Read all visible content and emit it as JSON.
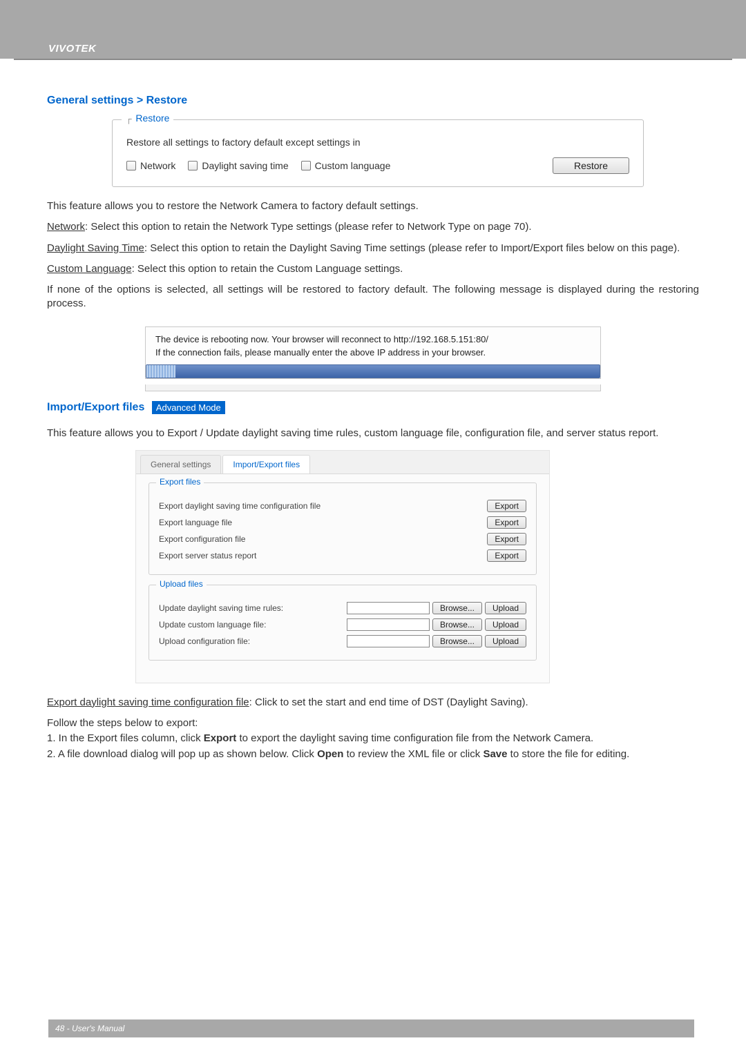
{
  "brand": "VIVOTEK",
  "section1_title": "General settings > Restore",
  "restore": {
    "legend": "Restore",
    "line1": "Restore all settings to factory default except settings in",
    "chk_network": "Network",
    "chk_dst": "Daylight saving time",
    "chk_lang": "Custom language",
    "button": "Restore"
  },
  "p1": "This feature allows you to restore the Network Camera to factory default settings.",
  "p2_u": "Network",
  "p2": ": Select this option to retain the Network Type settings (please refer to Network Type on page 70).",
  "p3_u": "Daylight Saving Time",
  "p3": ": Select this option to retain the Daylight Saving Time settings (please refer to Import/Export files below on this page).",
  "p4_u": "Custom Language",
  "p4": ": Select this option to retain the Custom Language settings.",
  "p5": "If none of the options is selected, all settings will be restored to factory default.  The following message is displayed during the restoring process.",
  "reboot": {
    "l1": "The device is rebooting now. Your browser will reconnect to http://192.168.5.151:80/",
    "l2": "If the connection fails, please manually enter the above IP address in your browser."
  },
  "section2_title": "Import/Export files",
  "section2_badge": "Advanced Mode",
  "p6": "This feature allows you to Export / Update daylight saving time rules, custom language file, configuration file, and server status report.",
  "ie": {
    "tab1": "General settings",
    "tab2": "Import/Export files",
    "export_legend": "Export files",
    "upload_legend": "Upload files",
    "rows_export": [
      "Export daylight saving time configuration file",
      "Export language file",
      "Export configuration file",
      "Export server status report"
    ],
    "rows_upload": [
      "Update daylight saving time rules:",
      "Update custom language file:",
      "Upload configuration file:"
    ],
    "export_btn": "Export",
    "browse_btn": "Browse...",
    "upload_btn": "Upload"
  },
  "p7_u": "Export daylight saving time configuration file",
  "p7": ": Click to set the start and end time of DST (Daylight Saving).",
  "p8": "Follow the steps below to export:",
  "li1a": "1. In the Export files column, click ",
  "li1b": "Export",
  "li1c": " to export the daylight saving time configuration file from the Network Camera.",
  "li2a": "2. A file download dialog will pop up as shown below. Click ",
  "li2b": "Open",
  "li2c": " to review the XML file or click ",
  "li2d": "Save",
  "li2e": " to store the file for editing.",
  "footer": "48 - User's Manual"
}
